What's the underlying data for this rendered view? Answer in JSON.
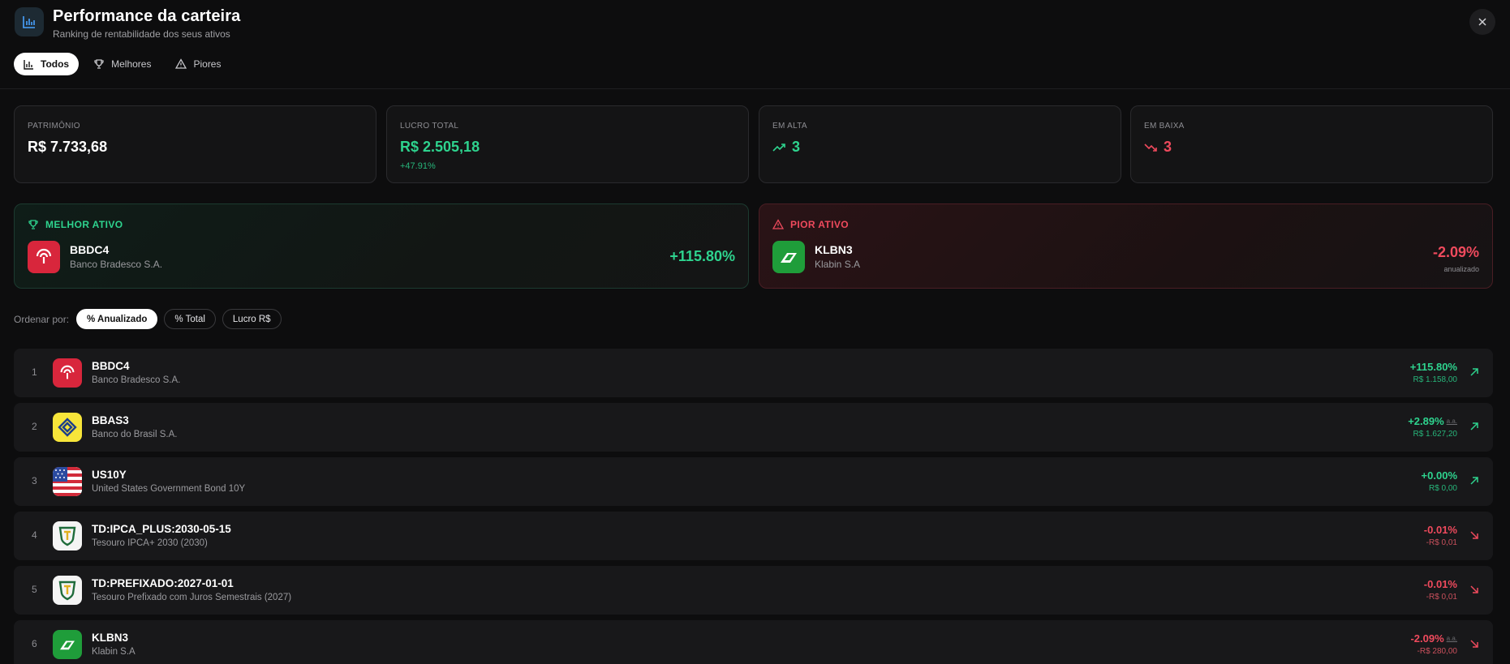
{
  "header": {
    "title": "Performance da carteira",
    "subtitle": "Ranking de rentabilidade dos seus ativos",
    "tabs": [
      {
        "label": "Todos",
        "icon": "bar-chart-icon",
        "active": true
      },
      {
        "label": "Melhores",
        "icon": "trophy-icon",
        "active": false
      },
      {
        "label": "Piores",
        "icon": "warning-icon",
        "active": false
      }
    ]
  },
  "summary": {
    "patrimonio": {
      "label": "PATRIMÔNIO",
      "value": "R$ 7.733,68"
    },
    "lucro": {
      "label": "LUCRO TOTAL",
      "value": "R$ 2.505,18",
      "sub": "+47.91%"
    },
    "alta": {
      "label": "EM ALTA",
      "value": "3"
    },
    "baixa": {
      "label": "EM BAIXA",
      "value": "3"
    }
  },
  "best": {
    "label": "MELHOR ATIVO",
    "ticker": "BBDC4",
    "name": "Banco Bradesco S.A.",
    "pct": "+115.80%"
  },
  "worst": {
    "label": "PIOR ATIVO",
    "ticker": "KLBN3",
    "name": "Klabin S.A",
    "pct": "-2.09%",
    "note": "anualizado"
  },
  "sort": {
    "label": "Ordenar por:",
    "options": [
      {
        "label": "% Anualizado",
        "active": true
      },
      {
        "label": "% Total",
        "active": false
      },
      {
        "label": "Lucro R$",
        "active": false
      }
    ]
  },
  "rows": [
    {
      "rank": "1",
      "ticker": "BBDC4",
      "name": "Banco Bradesco S.A.",
      "pct": "+115.80%",
      "aa": "",
      "value": "R$ 1.158,00",
      "trend": "up",
      "logo": "bradesco"
    },
    {
      "rank": "2",
      "ticker": "BBAS3",
      "name": "Banco do Brasil S.A.",
      "pct": "+2.89%",
      "aa": "a.a.",
      "value": "R$ 1.627,20",
      "trend": "up",
      "logo": "bb"
    },
    {
      "rank": "3",
      "ticker": "US10Y",
      "name": "United States Government Bond 10Y",
      "pct": "+0.00%",
      "aa": "",
      "value": "R$ 0,00",
      "trend": "up",
      "logo": "us-flag"
    },
    {
      "rank": "4",
      "ticker": "TD:IPCA_PLUS:2030-05-15",
      "name": "Tesouro IPCA+ 2030 (2030)",
      "pct": "-0.01%",
      "aa": "",
      "value": "-R$ 0,01",
      "trend": "down",
      "logo": "tesouro"
    },
    {
      "rank": "5",
      "ticker": "TD:PREFIXADO:2027-01-01",
      "name": "Tesouro Prefixado com Juros Semestrais (2027)",
      "pct": "-0.01%",
      "aa": "",
      "value": "-R$ 0,01",
      "trend": "down",
      "logo": "tesouro"
    },
    {
      "rank": "6",
      "ticker": "KLBN3",
      "name": "Klabin S.A",
      "pct": "-2.09%",
      "aa": "a.a.",
      "value": "-R$ 280,00",
      "trend": "down",
      "logo": "klabin"
    }
  ],
  "colors": {
    "accent_green": "#2ed38e",
    "accent_red": "#ef4a5d",
    "bradesco": "#d8263c",
    "bb_yellow": "#f7e53a",
    "klabin": "#1f9d3a"
  }
}
